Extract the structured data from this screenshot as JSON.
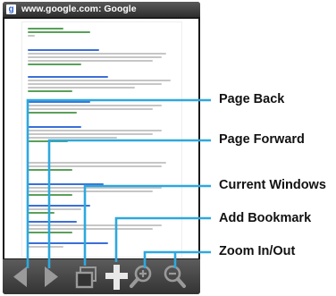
{
  "browser": {
    "title": "www.google.com: Google",
    "favicon_glyph": "g"
  },
  "toolbar": {
    "buttons": [
      {
        "name": "page-back-button",
        "icon": "left-arrow-icon"
      },
      {
        "name": "page-forward-button",
        "icon": "right-arrow-icon"
      },
      {
        "name": "current-windows-button",
        "icon": "windows-icon"
      },
      {
        "name": "add-bookmark-button",
        "icon": "plus-icon"
      },
      {
        "name": "zoom-in-button",
        "icon": "zoom-in-icon"
      },
      {
        "name": "zoom-out-button",
        "icon": "zoom-out-icon"
      }
    ]
  },
  "callouts": {
    "page_back": "Page Back",
    "page_forward": "Page Forward",
    "current_windows": "Current Windows",
    "add_bookmark": "Add Bookmark",
    "zoom": "Zoom In/Out"
  },
  "colors": {
    "callout_line": "#2ea8dd",
    "link": "#3a6fd8",
    "url_green": "#5aa05a"
  }
}
